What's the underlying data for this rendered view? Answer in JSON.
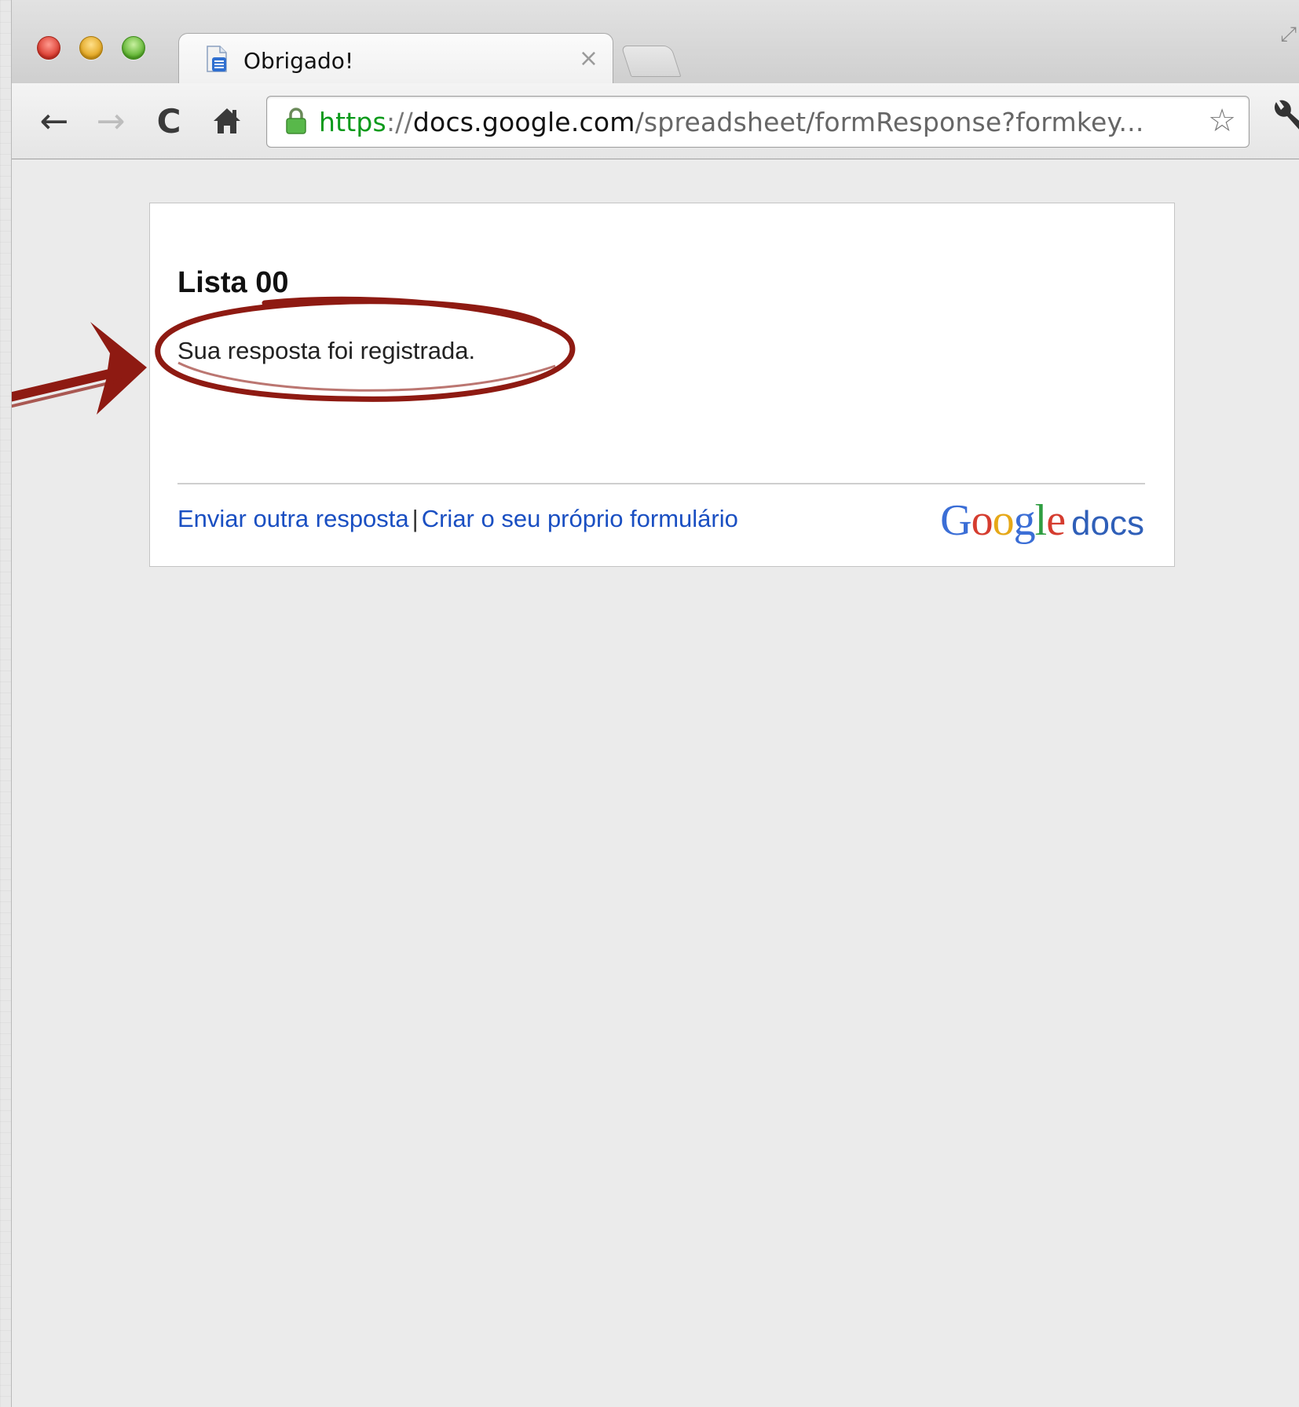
{
  "browser": {
    "tab": {
      "title": "Obrigado!",
      "close_glyph": "×"
    },
    "url": {
      "scheme": "https",
      "separator": "://",
      "host": "docs.google.com",
      "path": "/spreadsheet/formResponse?formkey..."
    },
    "icons": {
      "back": "←",
      "forward": "→",
      "reload": "C",
      "home": "⌂",
      "star": "☆"
    }
  },
  "form": {
    "title": "Lista 00",
    "message": "Sua resposta foi registrada.",
    "links": {
      "send_another": "Enviar outra resposta",
      "separator": "|",
      "create_own": "Criar o seu próprio formulário"
    },
    "logo": {
      "letters": [
        "G",
        "o",
        "o",
        "g",
        "l",
        "e"
      ],
      "colors": [
        "#3b6ed6",
        "#d53c2f",
        "#e6a817",
        "#3b6ed6",
        "#2f9e41",
        "#d53c2f"
      ],
      "product": "docs"
    }
  },
  "annotation": {
    "color": "#8e1a12"
  }
}
